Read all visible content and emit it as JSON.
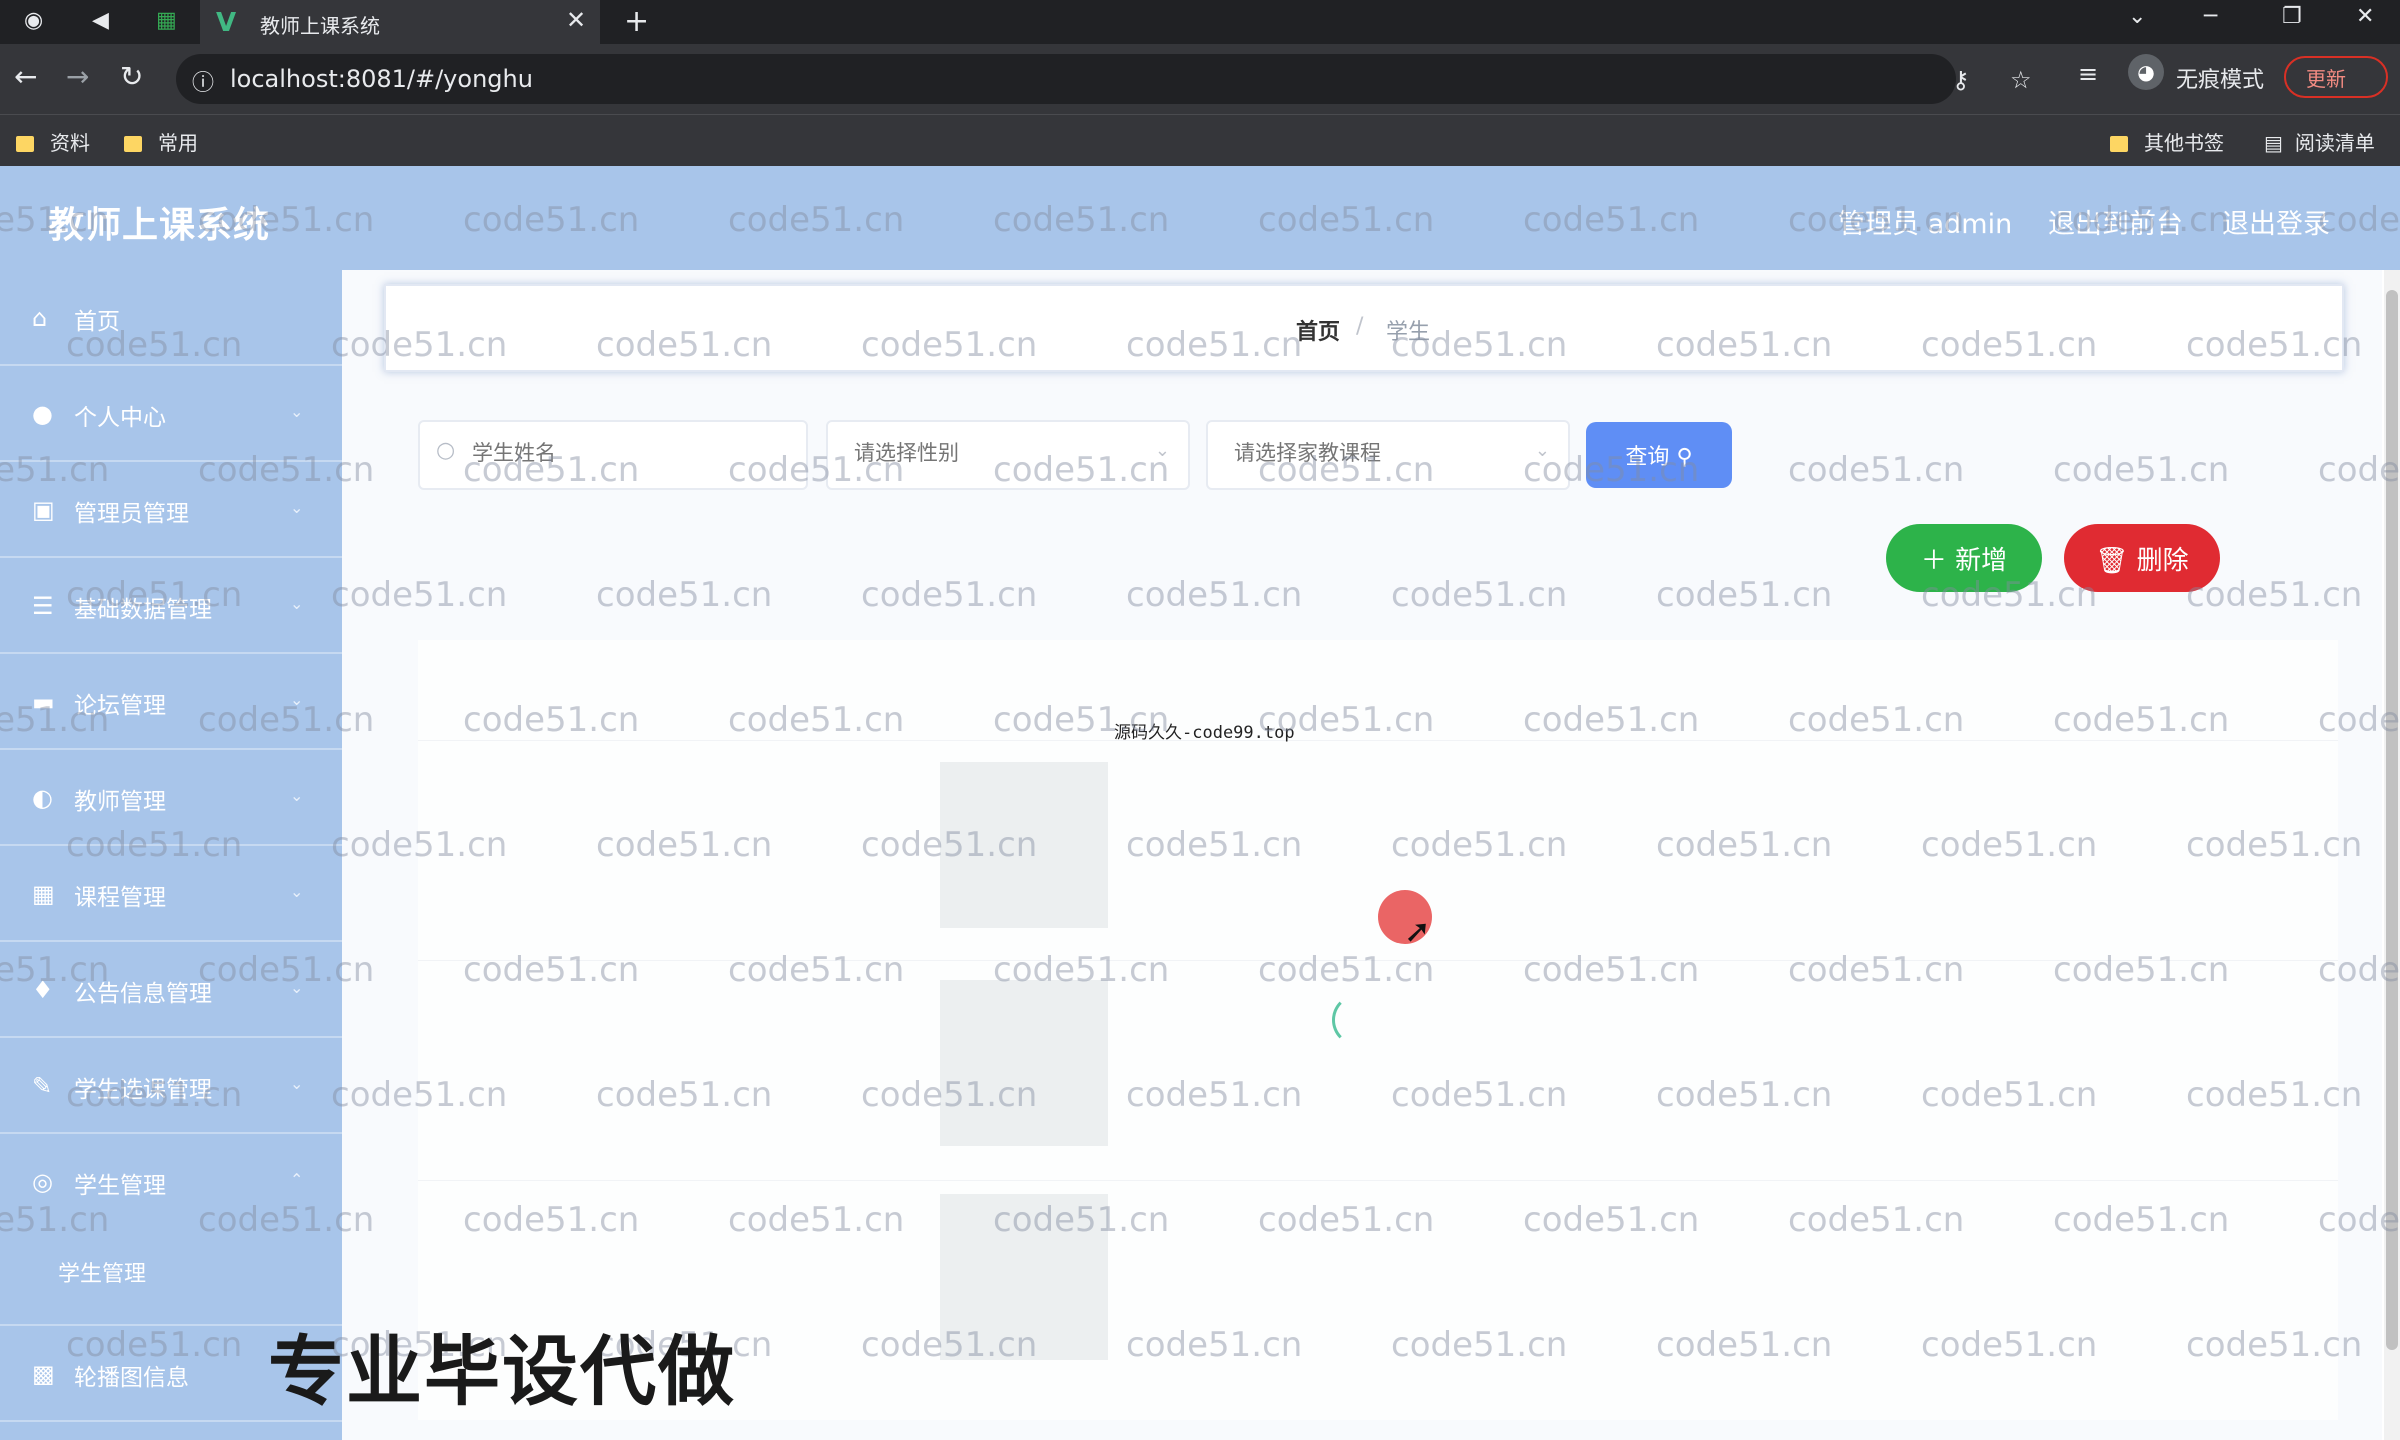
{
  "browser": {
    "tab_title": "教师上课系统",
    "tab_close": "✕",
    "new_tab": "+",
    "url": "localhost:8081/#/yonghu",
    "incognito_label": "无痕模式",
    "update_label": "更新",
    "bookmarks": [
      "资料",
      "常用"
    ],
    "other_bookmarks": "其他书签",
    "reading_list": "阅读清单"
  },
  "header": {
    "brand": "教师上课系统",
    "admin": "管理员 admin",
    "back_to_front": "退出到前台",
    "logout": "退出登录"
  },
  "sidebar": {
    "items": [
      {
        "label": "首页",
        "icon": "home-icon"
      },
      {
        "label": "个人中心",
        "icon": "user-icon"
      },
      {
        "label": "管理员管理",
        "icon": "admin-icon"
      },
      {
        "label": "基础数据管理",
        "icon": "list-icon"
      },
      {
        "label": "论坛管理",
        "icon": "forum-icon"
      },
      {
        "label": "教师管理",
        "icon": "teacher-icon"
      },
      {
        "label": "课程管理",
        "icon": "grid-icon"
      },
      {
        "label": "公告信息管理",
        "icon": "notice-icon"
      },
      {
        "label": "学生选课管理",
        "icon": "edit-icon"
      },
      {
        "label": "学生管理",
        "icon": "student-icon"
      },
      {
        "label": "轮播图信息",
        "icon": "image-icon"
      }
    ],
    "submenu_item": "学生管理"
  },
  "breadcrumb": {
    "home": "首页",
    "separator": "/",
    "current": "学生"
  },
  "search": {
    "name_placeholder": "学生姓名",
    "gender_placeholder": "请选择性别",
    "course_placeholder": "请选择家教课程",
    "query_label": "查询"
  },
  "actions": {
    "add_label": "＋ 新增",
    "delete_label": "🗑 删除"
  },
  "loading_text": "源码久久-code99.top",
  "watermark": "code51.cn",
  "promo": "专业毕设代做",
  "colors": {
    "header_bg": "#a8c5ea",
    "query": "#5f8ef5",
    "add": "#2db34a",
    "delete": "#e02b32"
  }
}
